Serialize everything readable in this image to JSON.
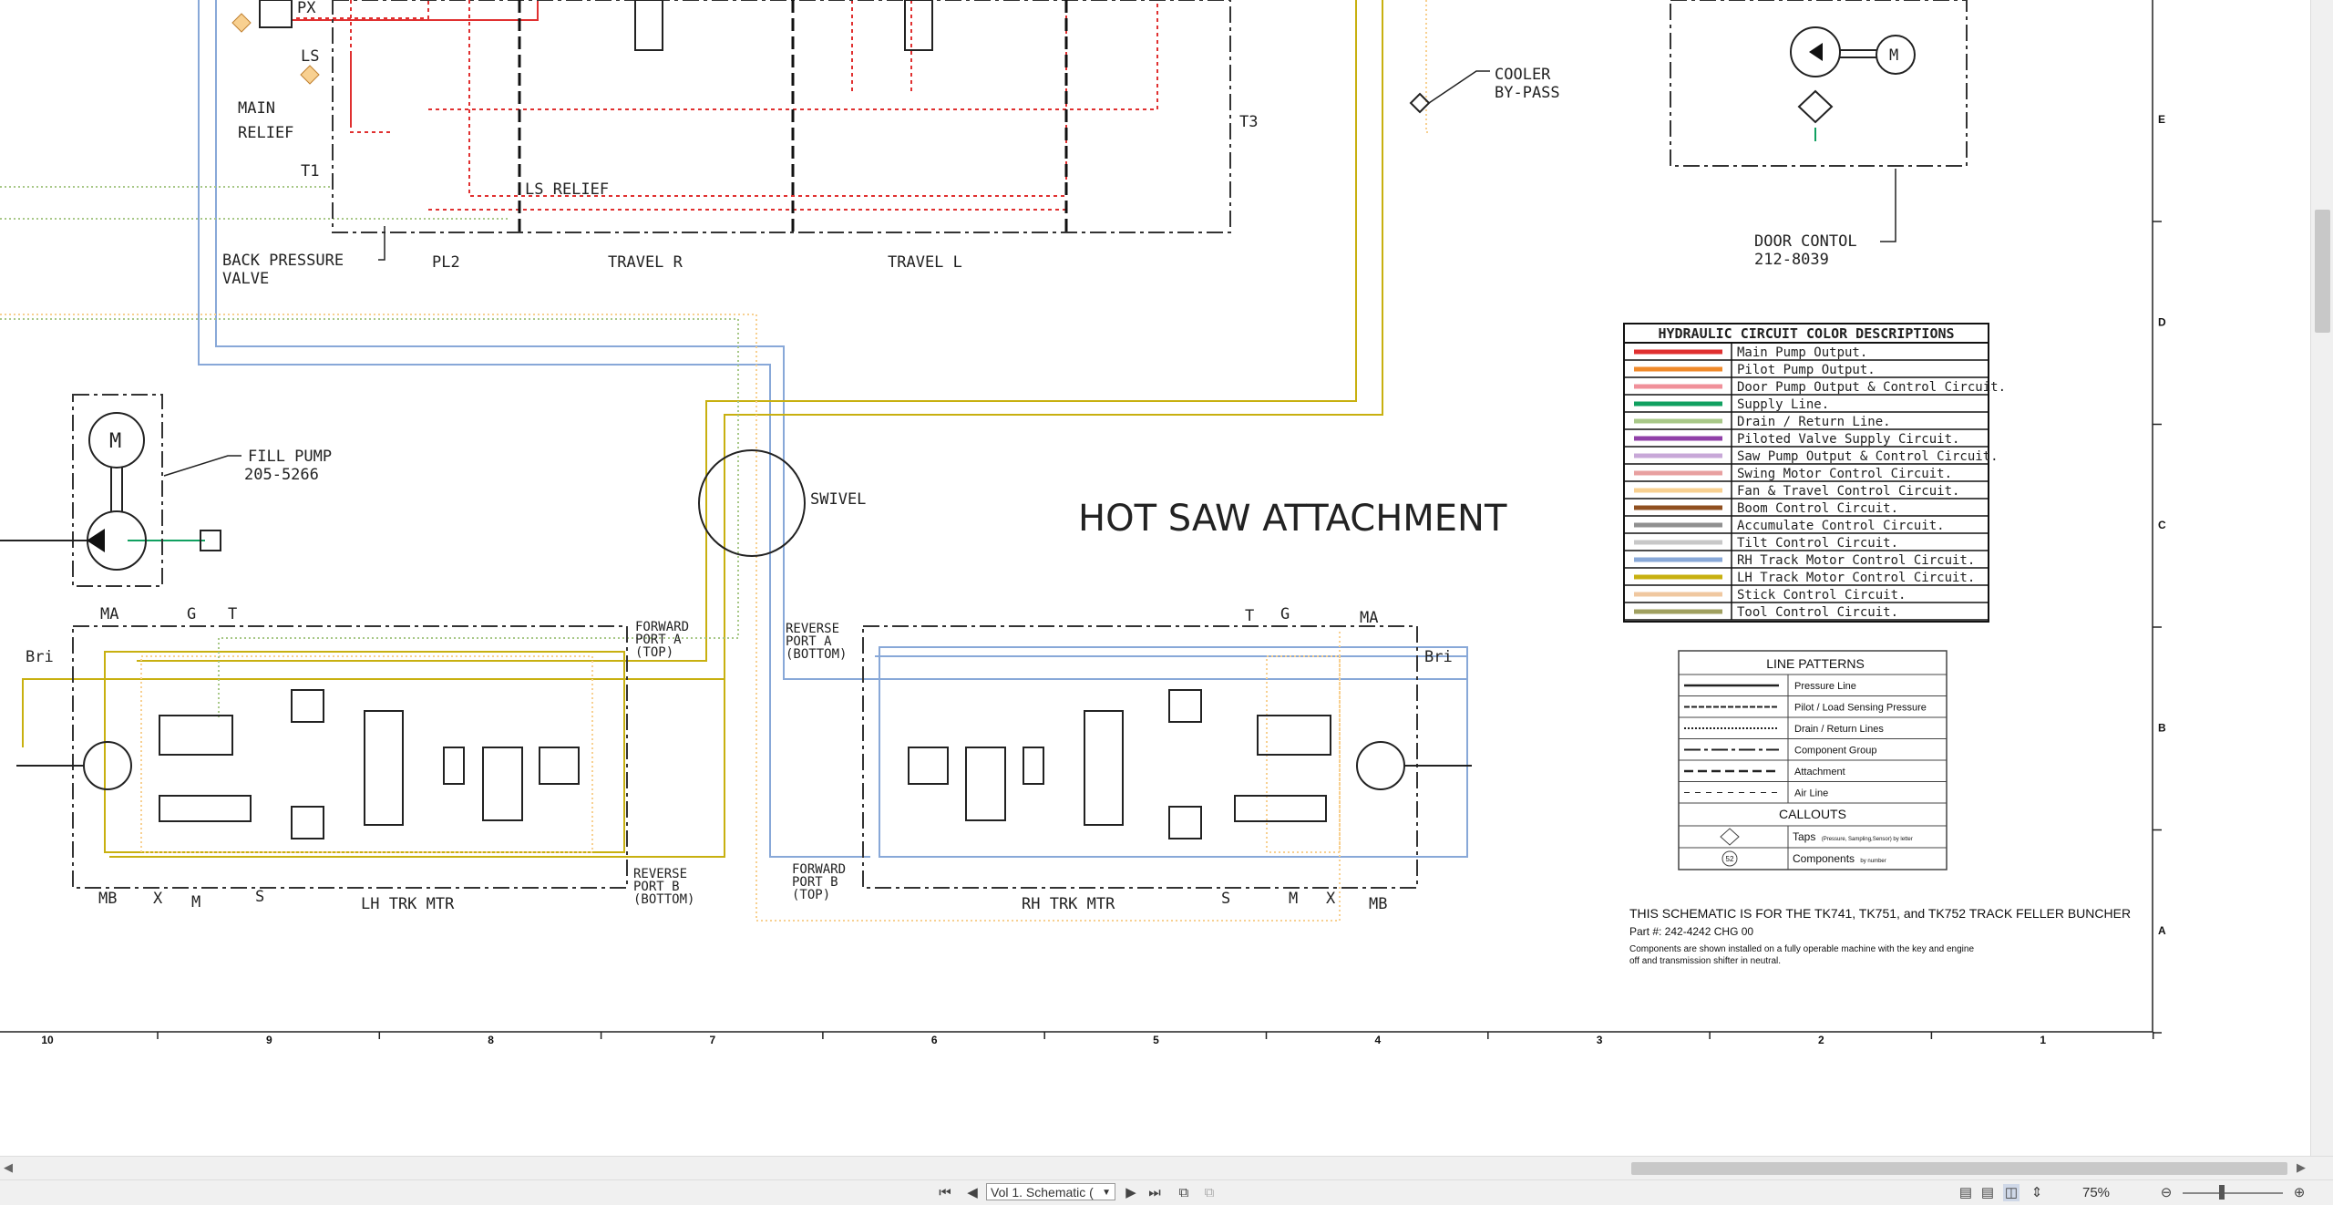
{
  "document": {
    "title": "HOT SAW ATTACHMENT",
    "labels": {
      "px": "PX",
      "ls": "LS",
      "main_relief_1": "MAIN",
      "main_relief_2": "RELIEF",
      "t1": "T1",
      "back_pressure_1": "BACK PRESSURE",
      "back_pressure_2": "VALVE",
      "pl2": "PL2",
      "ls_relief": "LS RELIEF",
      "travel_r": "TRAVEL R",
      "travel_l": "TRAVEL L",
      "t3": "T3",
      "cooler_1": "COOLER",
      "cooler_2": "BY-PASS",
      "door_control_1": "DOOR CONTOL",
      "door_control_2": "212-8039",
      "motor_m": "M",
      "fill_pump_1": "FILL PUMP",
      "fill_pump_2": "205-5266",
      "swivel": "SWIVEL",
      "ma": "MA",
      "g": "G",
      "t": "T",
      "bri": "Bri",
      "mb": "MB",
      "x": "X",
      "m": "M",
      "s": "S",
      "lh_trk_mtr": "LH TRK MTR",
      "rh_trk_mtr": "RH TRK MTR",
      "fwd_a_1": "FORWARD",
      "fwd_a_2": "PORT A",
      "fwd_a_3": "(TOP)",
      "rev_b_1": "REVERSE",
      "rev_b_2": "PORT B",
      "rev_b_3": "(BOTTOM)",
      "rev_a_1": "REVERSE",
      "rev_a_2": "PORT A",
      "rev_a_3": "(BOTTOM)",
      "fwd_b_1": "FORWARD",
      "fwd_b_2": "PORT B",
      "fwd_b_3": "(TOP)"
    },
    "color_legend": {
      "title": "HYDRAULIC CIRCUIT COLOR DESCRIPTIONS",
      "items": [
        {
          "label": "Main Pump Output.",
          "color": "#e03030"
        },
        {
          "label": "Pilot Pump Output.",
          "color": "#f08a2a"
        },
        {
          "label": "Door Pump Output & Control Circuit.",
          "color": "#f0909a"
        },
        {
          "label": "Supply Line.",
          "color": "#10a060"
        },
        {
          "label": "Drain / Return Line.",
          "color": "#a8c888"
        },
        {
          "label": "Piloted Valve Supply Circuit.",
          "color": "#9040a8"
        },
        {
          "label": "Saw Pump Output & Control Circuit.",
          "color": "#c8a8d8"
        },
        {
          "label": "Swing Motor Control Circuit.",
          "color": "#e8a0a0"
        },
        {
          "label": "Fan & Travel Control Circuit.",
          "color": "#f8d090"
        },
        {
          "label": "Boom Control Circuit.",
          "color": "#905020"
        },
        {
          "label": "Accumulate Control Circuit.",
          "color": "#909090"
        },
        {
          "label": "Tilt Control Circuit.",
          "color": "#c8c8c8"
        },
        {
          "label": "RH Track Motor Control Circuit.",
          "color": "#88a8d8"
        },
        {
          "label": "LH Track Motor Control Circuit.",
          "color": "#c8b010"
        },
        {
          "label": "Stick Control Circuit.",
          "color": "#f0c8a0"
        },
        {
          "label": "Tool Control Circuit.",
          "color": "#a0a060"
        }
      ]
    },
    "line_patterns": {
      "title": "LINE PATTERNS",
      "items": [
        "Pressure Line",
        "Pilot / Load Sensing Pressure",
        "Drain / Return Lines",
        "Component Group",
        "Attachment",
        "Air Line"
      ],
      "callouts_title": "CALLOUTS",
      "taps_label": "Taps",
      "taps_note": "(Pressure, Sampling,Sensor) by letter",
      "components_label": "Components",
      "components_note": "by number",
      "callout_symbol": "52"
    },
    "notes": {
      "heading": "THIS SCHEMATIC IS FOR THE TK741, TK751, and TK752 TRACK FELLER BUNCHER",
      "part": "Part #: 242-4242 CHG 00",
      "line1": "Components are shown installed on a fully operable machine with the key and engine",
      "line2": "off and transmission shifter in neutral."
    },
    "grid_columns": [
      "10",
      "9",
      "8",
      "7",
      "6",
      "5",
      "4",
      "3",
      "2",
      "1"
    ],
    "grid_rows": [
      "E",
      "D",
      "C",
      "B",
      "A"
    ]
  },
  "statusbar": {
    "page_select": "Vol 1. Schematic (",
    "zoom": "75%"
  },
  "colors": {
    "lh_track": "#c8b010",
    "rh_track": "#88a8d8",
    "main_pump": "#e03030",
    "fan_travel": "#f8d090",
    "supply": "#10a060"
  }
}
